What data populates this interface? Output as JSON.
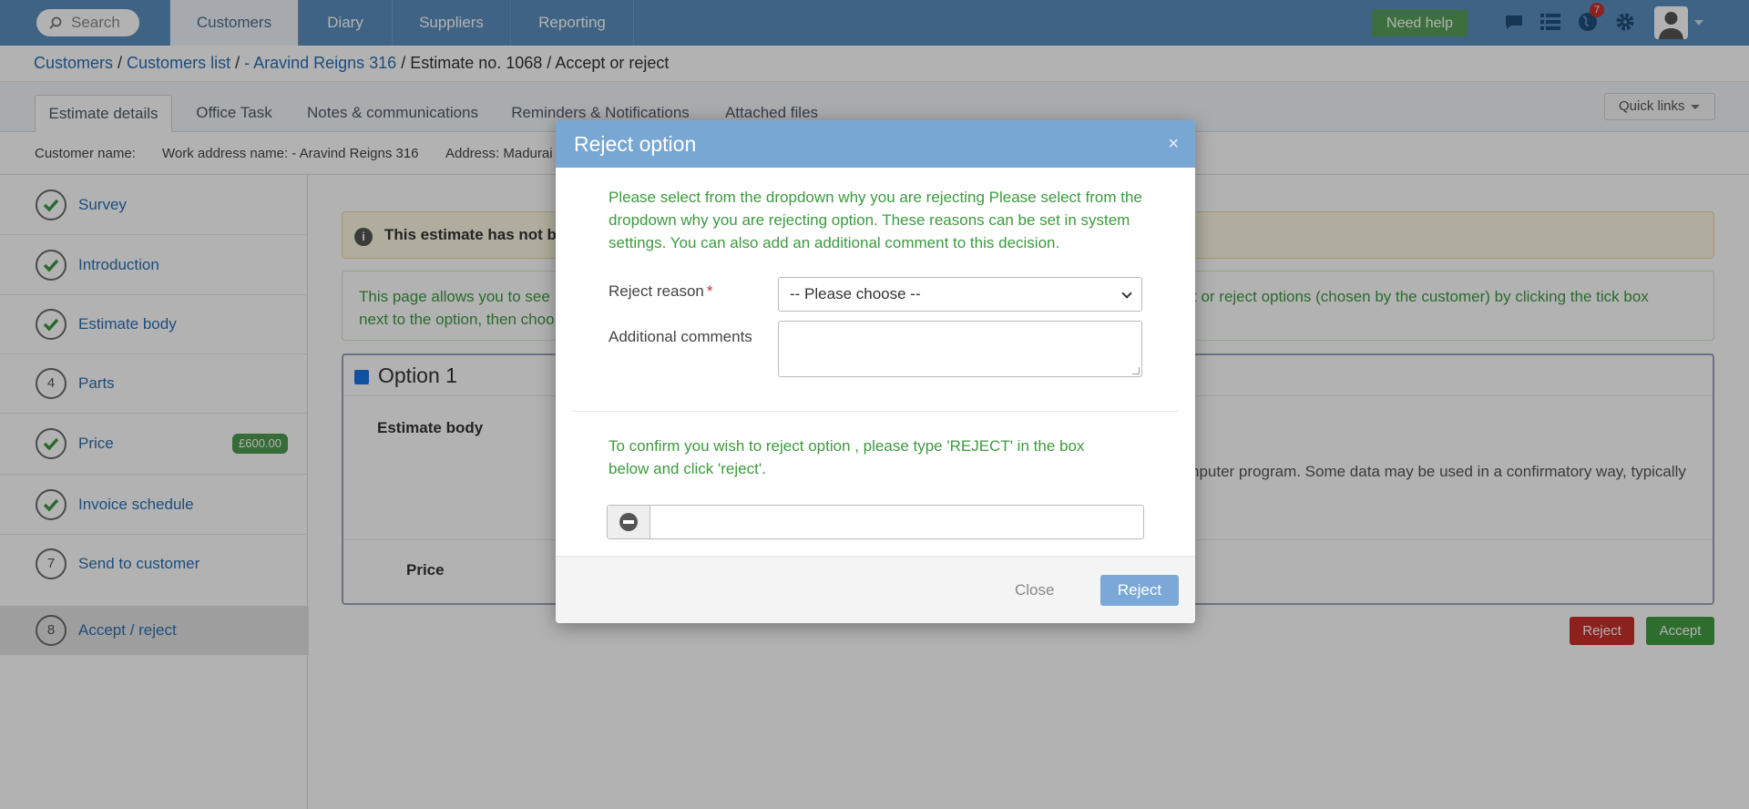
{
  "topnav": {
    "search_placeholder": "Search",
    "tabs": [
      "Customers",
      "Diary",
      "Suppliers",
      "Reporting"
    ],
    "need_help": "Need help",
    "notification_count": "7"
  },
  "breadcrumb": {
    "items": [
      "Customers",
      "Customers list",
      "- Aravind Reigns 316"
    ],
    "current": "Estimate no. 1068 / Accept or reject"
  },
  "page_tabs": [
    "Estimate details",
    "Office Task",
    "Notes & communications",
    "Reminders & Notifications",
    "Attached files"
  ],
  "quick_links": "Quick links",
  "infobar": {
    "customer_name_label": "Customer name:",
    "work_address_label": "Work address name: - Aravind Reigns 316",
    "address_label": "Address: Madurai"
  },
  "sidebar": {
    "steps": [
      {
        "num": "",
        "label": "Survey"
      },
      {
        "num": "",
        "label": "Introduction"
      },
      {
        "num": "",
        "label": "Estimate body"
      },
      {
        "num": "4",
        "label": "Parts"
      },
      {
        "num": "",
        "label": "Price",
        "badge": "£600.00"
      },
      {
        "num": "",
        "label": "Invoice schedule"
      },
      {
        "num": "7",
        "label": "Send to customer"
      },
      {
        "num": "8",
        "label": "Accept / reject"
      }
    ]
  },
  "main": {
    "warning": "This estimate has not b",
    "info_left": "This page allows you to see",
    "info_left2": "next to the option, then choo",
    "info_right": "t or reject options (chosen by the customer) by clicking the tick box",
    "option_title": "Option 1",
    "estimate_body_label": "Estimate body",
    "estimate_body_text": "nputer program. Some data may be used in a confirmatory way, typically",
    "price_label": "Price",
    "reject": "Reject",
    "accept": "Accept"
  },
  "modal": {
    "title": "Reject option",
    "close_x": "×",
    "intro": "Please select from the dropdown why you are rejecting Please select from the dropdown why you are rejecting option. These reasons can be set in system settings. You can also add an additional comment to this decision.",
    "reject_reason_label": "Reject reason",
    "required_mark": "*",
    "select_value": "-- Please choose --",
    "comments_label": "Additional comments",
    "confirm_text": "To confirm you wish to reject option , please type 'REJECT' in the box below and click 'reject'.",
    "close_button": "Close",
    "reject_button": "Reject"
  }
}
